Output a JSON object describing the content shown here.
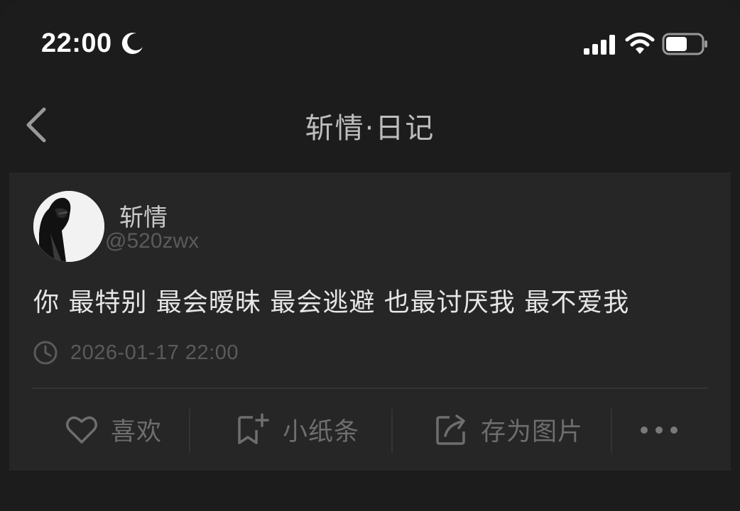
{
  "status_bar": {
    "time": "22:00",
    "moon_icon": "moon-icon",
    "signal_icon": "cellular-signal-icon",
    "wifi_icon": "wifi-icon",
    "battery_icon": "battery-icon",
    "battery_level": 0.6
  },
  "nav": {
    "back_icon": "chevron-left-icon",
    "title": "斩情·日记"
  },
  "post": {
    "username": "斩情",
    "handle": "@520zwx",
    "content": "你 最特别 最会暧昧 最会逃避 也最讨厌我 最不爱我",
    "timestamp": "2026-01-17 22:00",
    "clock_icon": "clock-icon"
  },
  "actions": [
    {
      "label": "喜欢",
      "icon": "heart-icon"
    },
    {
      "label": "小纸条",
      "icon": "note-add-icon"
    },
    {
      "label": "存为图片",
      "icon": "share-image-icon"
    },
    {
      "label": "",
      "icon": "more-icon"
    }
  ],
  "colors": {
    "background": "#1c1c1c",
    "card": "#262626",
    "muted_text": "#5b5b5b",
    "action_text": "#6e6e6e"
  }
}
